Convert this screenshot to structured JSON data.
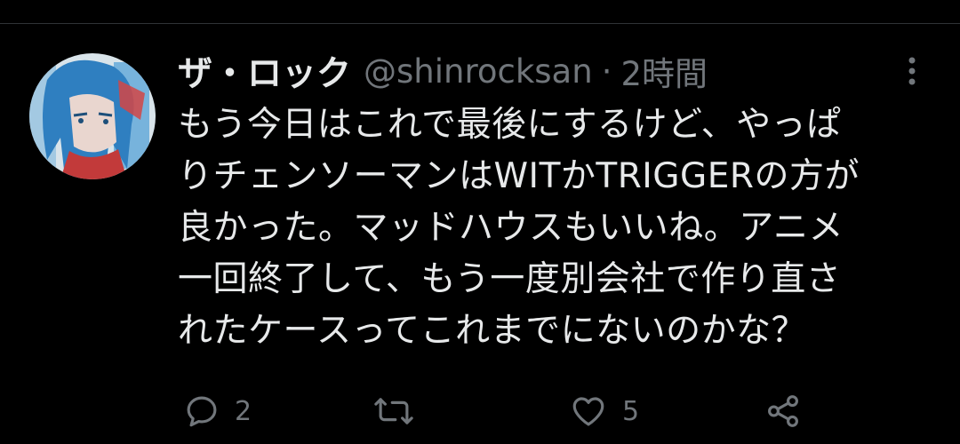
{
  "tweet": {
    "display_name": "ザ・ロック",
    "handle": "@shinrocksan",
    "separator": "·",
    "time": "2時間",
    "text_lines": [
      "もう今日はこれで最後にするけど、やっぱ",
      "りチェンソーマンはWITかTRIGGERの方が",
      "良かった。マッドハウスもいいね。アニメ",
      "一回終了して、もう一度別会社で作り直さ",
      "れたケースってこれまでにないのかな？"
    ]
  },
  "actions": {
    "reply_count": "2",
    "like_count": "5"
  },
  "icons": {
    "more": "more-vertical-icon",
    "reply": "reply-icon",
    "retweet": "retweet-icon",
    "like": "heart-icon",
    "share": "share-icon"
  },
  "colors": {
    "background": "#000000",
    "text_primary": "#e7e9ea",
    "text_secondary": "#71767b"
  }
}
